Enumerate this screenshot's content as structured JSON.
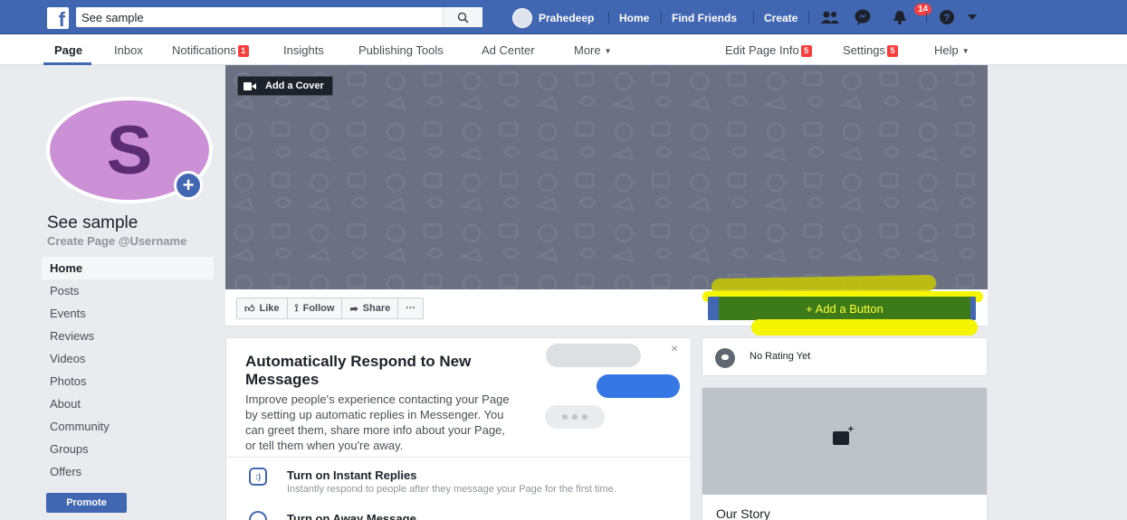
{
  "topbar": {
    "search_value": "See sample",
    "profile_name": "Prahedeep",
    "nav": [
      "Home",
      "Find Friends",
      "Create"
    ],
    "notifications_count": "14"
  },
  "page_tabs": [
    {
      "label": "Page"
    },
    {
      "label": "Inbox"
    },
    {
      "label": "Notifications",
      "badge": "1"
    },
    {
      "label": "Insights"
    },
    {
      "label": "Publishing Tools"
    },
    {
      "label": "Ad Center"
    },
    {
      "label": "More"
    },
    {
      "label": "Edit Page Info",
      "badge": "5"
    },
    {
      "label": "Settings",
      "badge": "5"
    },
    {
      "label": "Help"
    }
  ],
  "profile": {
    "initial": "S",
    "name": "See sample",
    "username": "Create Page @Username"
  },
  "left_nav": [
    "Home",
    "Posts",
    "Events",
    "Reviews",
    "Videos",
    "Photos",
    "About",
    "Community",
    "Groups",
    "Offers"
  ],
  "promote_label": "Promote",
  "cover": {
    "add_cover_label": "Add a Cover"
  },
  "actions": {
    "like": "Like",
    "follow": "Follow",
    "share": "Share",
    "more": "···",
    "add_button": "+ Add a Button"
  },
  "card": {
    "close": "×",
    "title": "Automatically Respond to New Messages",
    "body": "Improve people's experience contacting your Page by setting up automatic replies in Messenger. You can greet them, share more info about your Page, or tell them when you're away.",
    "row1_title": "Turn on Instant Replies",
    "row1_sub": "Instantly respond to people after they message your Page for the first time.",
    "row2_title": "Turn on Away Message"
  },
  "rating": {
    "text": "No Rating Yet"
  },
  "story": {
    "title": "Our Story"
  },
  "colors": {
    "brand": "#4267b2",
    "badge": "#fa3e3e",
    "highlight": "#f5f500"
  }
}
